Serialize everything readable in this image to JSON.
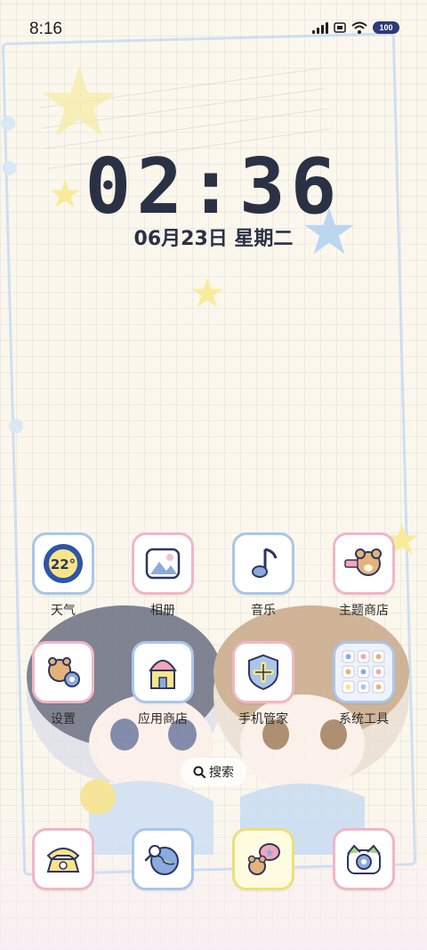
{
  "status_bar": {
    "time": "8:16",
    "battery": "100",
    "icons": [
      "signal-icon",
      "hd-icon",
      "wifi-icon",
      "battery-icon"
    ]
  },
  "lockclock": {
    "time": "02:36",
    "date": "06月23日 星期二"
  },
  "apps": [
    {
      "label": "天气",
      "icon": "weather-icon",
      "text": "22°"
    },
    {
      "label": "相册",
      "icon": "gallery-icon"
    },
    {
      "label": "音乐",
      "icon": "music-icon"
    },
    {
      "label": "主题商店",
      "icon": "theme-store-icon"
    },
    {
      "label": "设置",
      "icon": "settings-icon"
    },
    {
      "label": "应用商店",
      "icon": "app-store-icon"
    },
    {
      "label": "手机管家",
      "icon": "phone-manager-icon"
    },
    {
      "label": "系统工具",
      "icon": "system-tools-folder-icon"
    }
  ],
  "search": {
    "label": "搜索"
  },
  "dock": [
    {
      "icon": "phone-icon"
    },
    {
      "icon": "browser-icon"
    },
    {
      "icon": "messages-icon"
    },
    {
      "icon": "camera-icon"
    }
  ],
  "colors": {
    "accent_blue": "#a9c6ea",
    "accent_pink": "#f1b6c6",
    "clock_text": "#2b3144"
  }
}
